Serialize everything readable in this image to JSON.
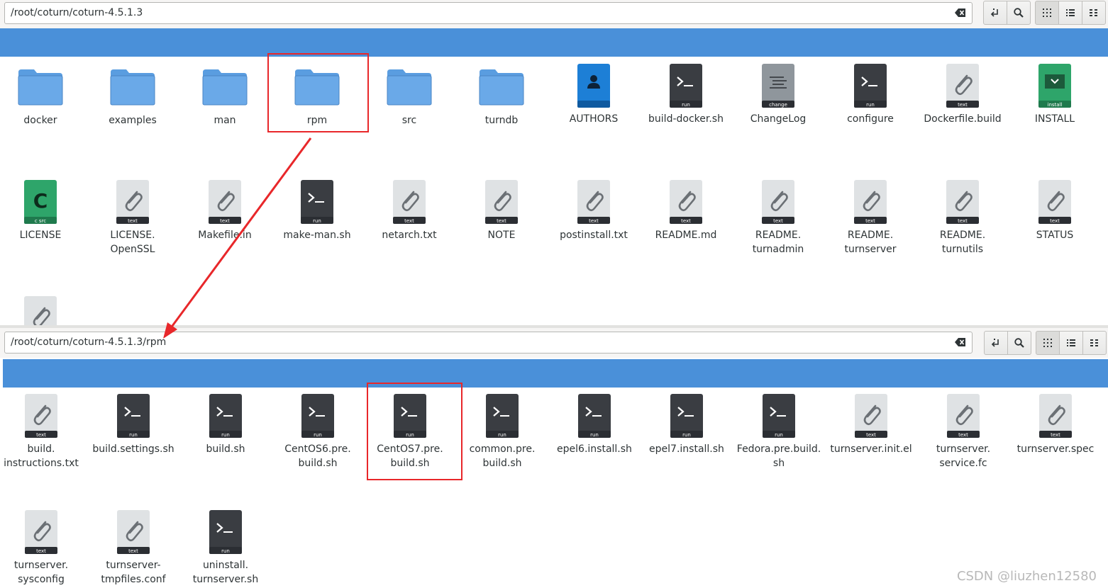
{
  "top_window": {
    "path": "/root/coturn/coturn-4.5.1.3",
    "items": [
      {
        "name": "docker",
        "icon": "folder-icon"
      },
      {
        "name": "examples",
        "icon": "folder-icon"
      },
      {
        "name": "man",
        "icon": "folder-icon"
      },
      {
        "name": "rpm",
        "icon": "folder-icon"
      },
      {
        "name": "src",
        "icon": "folder-icon"
      },
      {
        "name": "turndb",
        "icon": "folder-icon"
      },
      {
        "name": "AUTHORS",
        "icon": "authors-icon"
      },
      {
        "name": "build-docker.sh",
        "icon": "run-icon",
        "badge": "run"
      },
      {
        "name": "ChangeLog",
        "icon": "changelog-icon",
        "badge": "change"
      },
      {
        "name": "configure",
        "icon": "run-icon",
        "badge": "run"
      },
      {
        "name": "Dockerfile.build",
        "icon": "text-icon",
        "badge": "text"
      },
      {
        "name": "INSTALL",
        "icon": "install-icon",
        "badge": "install"
      },
      {
        "name": "LICENSE",
        "icon": "c-src-icon",
        "badge": "c src"
      },
      {
        "name": "LICENSE.\nOpenSSL",
        "icon": "text-icon",
        "badge": "text"
      },
      {
        "name": "Makefile.in",
        "icon": "text-icon",
        "badge": "text"
      },
      {
        "name": "make-man.sh",
        "icon": "run-icon",
        "badge": "run"
      },
      {
        "name": "netarch.txt",
        "icon": "text-icon",
        "badge": "text"
      },
      {
        "name": "NOTE",
        "icon": "text-icon",
        "badge": "text"
      },
      {
        "name": "postinstall.txt",
        "icon": "text-icon",
        "badge": "text"
      },
      {
        "name": "README.md",
        "icon": "text-icon",
        "badge": "text"
      },
      {
        "name": "README.\nturnadmin",
        "icon": "text-icon",
        "badge": "text"
      },
      {
        "name": "README.\nturnserver",
        "icon": "text-icon",
        "badge": "text"
      },
      {
        "name": "README.\nturnutils",
        "icon": "text-icon",
        "badge": "text"
      },
      {
        "name": "STATUS",
        "icon": "text-icon",
        "badge": "text"
      },
      {
        "name": "",
        "icon": "text-icon",
        "badge": "text",
        "partial": true
      }
    ]
  },
  "bottom_window": {
    "path": "/root/coturn/coturn-4.5.1.3/rpm",
    "items": [
      {
        "name": "build.\ninstructions.txt",
        "icon": "text-icon",
        "badge": "text"
      },
      {
        "name": "build.settings.sh",
        "icon": "run-icon",
        "badge": "run"
      },
      {
        "name": "build.sh",
        "icon": "run-icon",
        "badge": "run"
      },
      {
        "name": "CentOS6.pre.\nbuild.sh",
        "icon": "run-icon",
        "badge": "run"
      },
      {
        "name": "CentOS7.pre.\nbuild.sh",
        "icon": "run-icon",
        "badge": "run"
      },
      {
        "name": "common.pre.\nbuild.sh",
        "icon": "run-icon",
        "badge": "run"
      },
      {
        "name": "epel6.install.sh",
        "icon": "run-icon",
        "badge": "run"
      },
      {
        "name": "epel7.install.sh",
        "icon": "run-icon",
        "badge": "run"
      },
      {
        "name": "Fedora.pre.build.\nsh",
        "icon": "run-icon",
        "badge": "run"
      },
      {
        "name": "turnserver.init.el",
        "icon": "text-icon",
        "badge": "text"
      },
      {
        "name": "turnserver.\nservice.fc",
        "icon": "text-icon",
        "badge": "text"
      },
      {
        "name": "turnserver.spec",
        "icon": "text-icon",
        "badge": "text"
      },
      {
        "name": "turnserver.\nsysconfig",
        "icon": "text-icon",
        "badge": "text"
      },
      {
        "name": "turnserver-\ntmpfiles.conf",
        "icon": "text-icon",
        "badge": "text"
      },
      {
        "name": "uninstall.\nturnserver.sh",
        "icon": "run-icon",
        "badge": "run"
      }
    ]
  },
  "watermark": "CSDN @liuzhen12580",
  "colors": {
    "accent": "#4a90d9",
    "highlight": "#e8272a",
    "folder": "#5a9de0"
  }
}
